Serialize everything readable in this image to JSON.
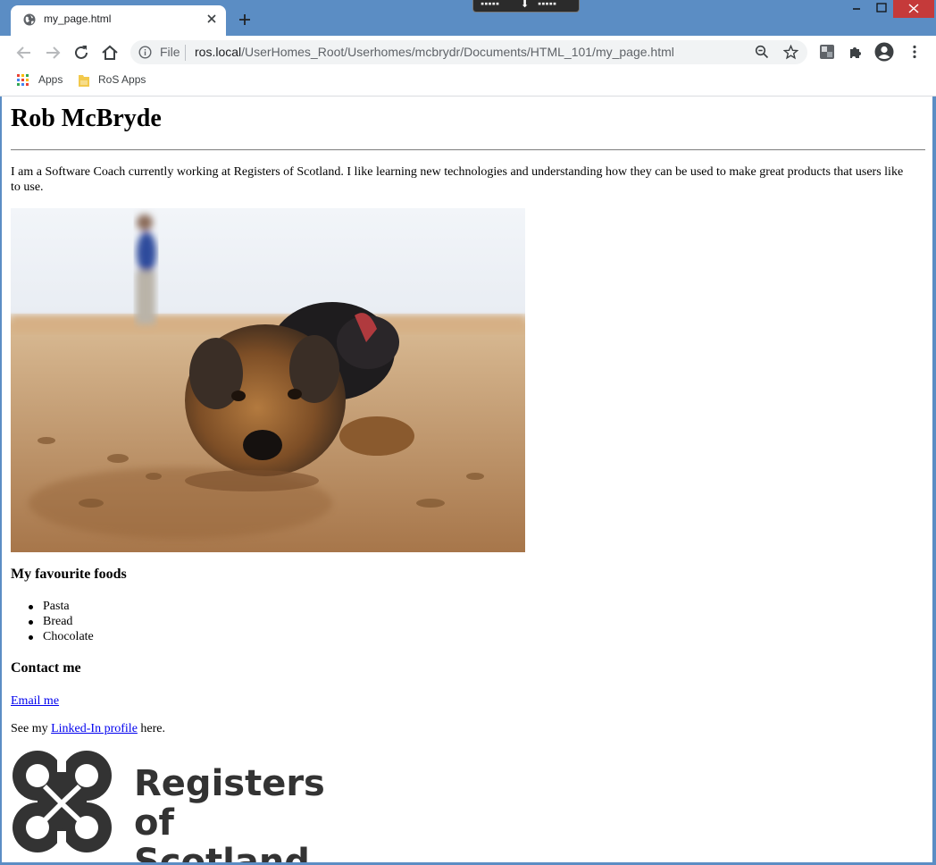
{
  "browser": {
    "tab_title": "my_page.html",
    "omnibox": {
      "scheme_label": "File",
      "url_host": "ros.local",
      "url_path": "/UserHomes_Root/Userhomes/mcbrydr/Documents/HTML_101/my_page.html"
    },
    "bookmarks": [
      {
        "label": "Apps",
        "icon": "apps-grid-icon"
      },
      {
        "label": "RoS Apps",
        "icon": "folder-icon"
      }
    ],
    "colors": {
      "frame": "#5b8dc4",
      "close_button": "#c53a3a"
    }
  },
  "page": {
    "heading": "Rob McBryde",
    "intro": "I am a Software Coach currently working at Registers of Scotland. I like learning new technologies and understanding how they can be used to make great products that users like to use.",
    "image_icon": "dog-photo",
    "foods_heading": "My favourite foods",
    "foods": [
      "Pasta",
      "Bread",
      "Chocolate"
    ],
    "contact_heading": "Contact me",
    "email_link": "Email me",
    "linkedin_prefix": "See my ",
    "linkedin_link": "Linked-In profile",
    "linkedin_suffix": " here.",
    "logo_line1": "Registers",
    "logo_line2": "of Scotland",
    "link_color": "#0000ee"
  }
}
